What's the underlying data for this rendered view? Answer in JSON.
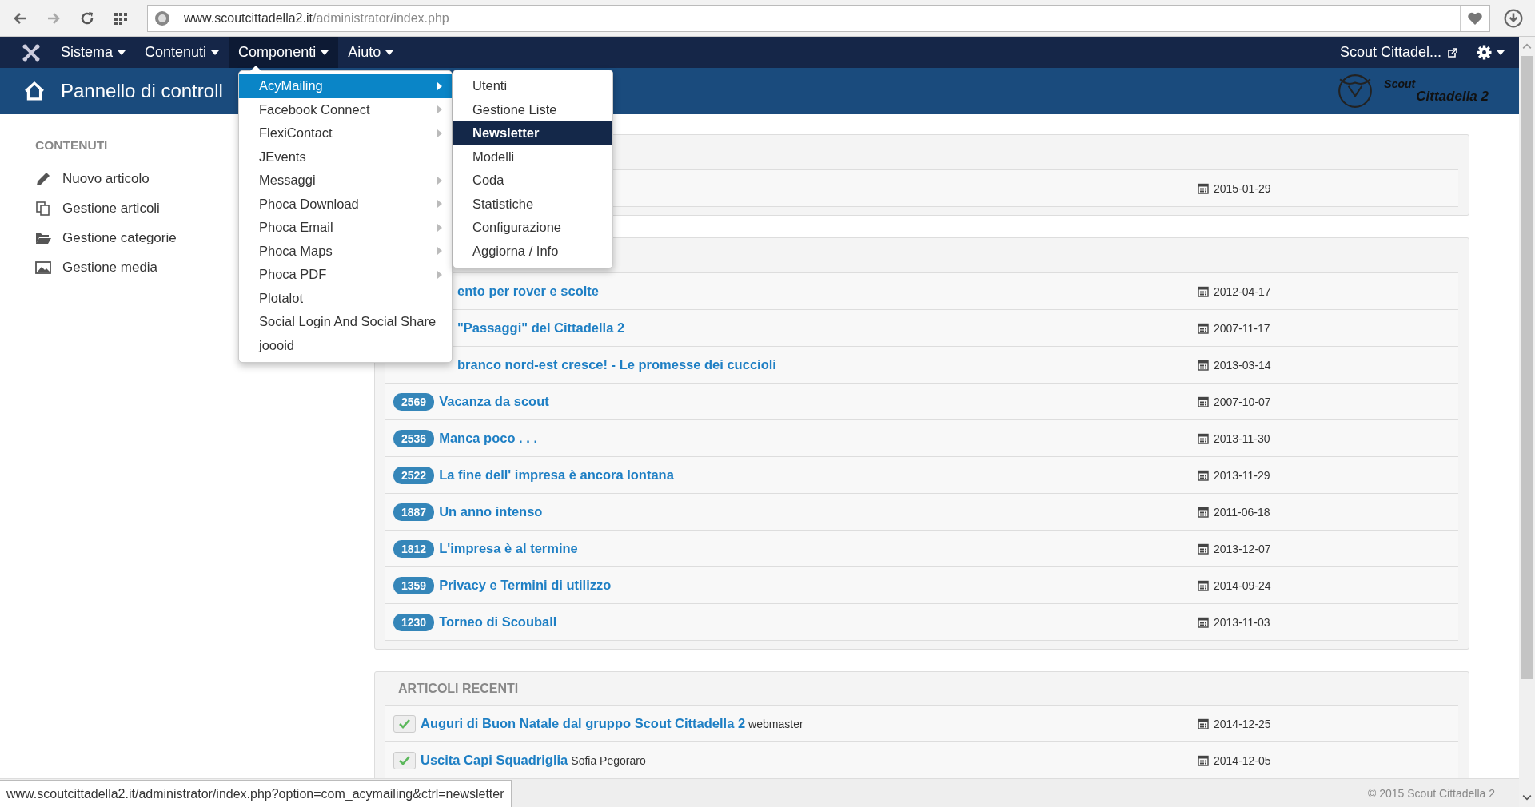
{
  "browser": {
    "url_host": "www.scoutcittadella2.it",
    "url_path": "/administrator/index.php"
  },
  "navbar": {
    "menus": [
      {
        "label": "Sistema",
        "selected": false
      },
      {
        "label": "Contenuti",
        "selected": false
      },
      {
        "label": "Componenti",
        "selected": true
      },
      {
        "label": "Aiuto",
        "selected": false
      }
    ],
    "site_link": "Scout Cittadel..."
  },
  "header": {
    "title": "Pannello di controll",
    "logo_lines": [
      "Scout",
      "Cittadella 2"
    ]
  },
  "sidebar": {
    "heading": "CONTENUTI",
    "items": [
      {
        "label": "Nuovo articolo",
        "kind": "pencil"
      },
      {
        "label": "Gestione articoli",
        "kind": "copies"
      },
      {
        "label": "Gestione categorie",
        "kind": "folder"
      },
      {
        "label": "Gestione media",
        "kind": "image"
      }
    ]
  },
  "dropdown": {
    "items": [
      {
        "label": "AcyMailing",
        "has_submenu": true,
        "selected": true
      },
      {
        "label": "Facebook Connect",
        "has_submenu": true,
        "selected": false
      },
      {
        "label": "FlexiContact",
        "has_submenu": true,
        "selected": false
      },
      {
        "label": "JEvents",
        "has_submenu": false,
        "selected": false
      },
      {
        "label": "Messaggi",
        "has_submenu": true,
        "selected": false
      },
      {
        "label": "Phoca Download",
        "has_submenu": true,
        "selected": false
      },
      {
        "label": "Phoca Email",
        "has_submenu": true,
        "selected": false
      },
      {
        "label": "Phoca Maps",
        "has_submenu": true,
        "selected": false
      },
      {
        "label": "Phoca PDF",
        "has_submenu": true,
        "selected": false
      },
      {
        "label": "Plotalot",
        "has_submenu": false,
        "selected": false
      },
      {
        "label": "Social Login And Social Share",
        "has_submenu": false,
        "selected": false
      },
      {
        "label": "joooid",
        "has_submenu": false,
        "selected": false
      }
    ]
  },
  "submenu": {
    "items": [
      {
        "label": "Utenti",
        "selected": false
      },
      {
        "label": "Gestione Liste",
        "selected": false
      },
      {
        "label": "Newsletter",
        "selected": true
      },
      {
        "label": "Modelli",
        "selected": false
      },
      {
        "label": "Coda",
        "selected": false
      },
      {
        "label": "Statistiche",
        "selected": false
      },
      {
        "label": "Configurazione",
        "selected": false
      },
      {
        "label": "Aggiorna / Info",
        "selected": false
      }
    ]
  },
  "panels": [
    {
      "rows": [
        {
          "date": "2015-01-29"
        }
      ]
    },
    {
      "rows": [
        {
          "title": "ento per rover e scolte",
          "date": "2012-04-17"
        },
        {
          "title": "\"Passaggi\" del Cittadella 2",
          "date": "2007-11-17"
        },
        {
          "title": "branco nord-est cresce! - Le promesse dei cuccioli",
          "date": "2013-03-14"
        },
        {
          "badge": "2569",
          "title": "Vacanza da scout",
          "date": "2007-10-07"
        },
        {
          "badge": "2536",
          "title": "Manca poco . . .",
          "date": "2013-11-30"
        },
        {
          "badge": "2522",
          "title": "La fine dell' impresa è ancora lontana",
          "date": "2013-11-29"
        },
        {
          "badge": "1887",
          "title": "Un anno intenso",
          "date": "2011-06-18"
        },
        {
          "badge": "1812",
          "title": "L'impresa è al termine",
          "date": "2013-12-07"
        },
        {
          "badge": "1359",
          "title": "Privacy e Termini di utilizzo",
          "date": "2014-09-24"
        },
        {
          "badge": "1230",
          "title": "Torneo di Scouball",
          "date": "2013-11-03"
        }
      ]
    },
    {
      "heading": "ARTICOLI RECENTI",
      "rows": [
        {
          "published": true,
          "title": "Auguri di Buon Natale dal gruppo Scout Cittadella 2",
          "author": "webmaster",
          "date": "2014-12-25"
        },
        {
          "published": true,
          "title": "Uscita Capi Squadriglia",
          "author": "Sofia Pegoraro",
          "date": "2014-12-05"
        }
      ]
    }
  ],
  "footer": "© 2015 Scout Cittadella 2",
  "status_url": "www.scoutcittadella2.it/administrator/index.php?option=com_acymailing&ctrl=newsletter"
}
